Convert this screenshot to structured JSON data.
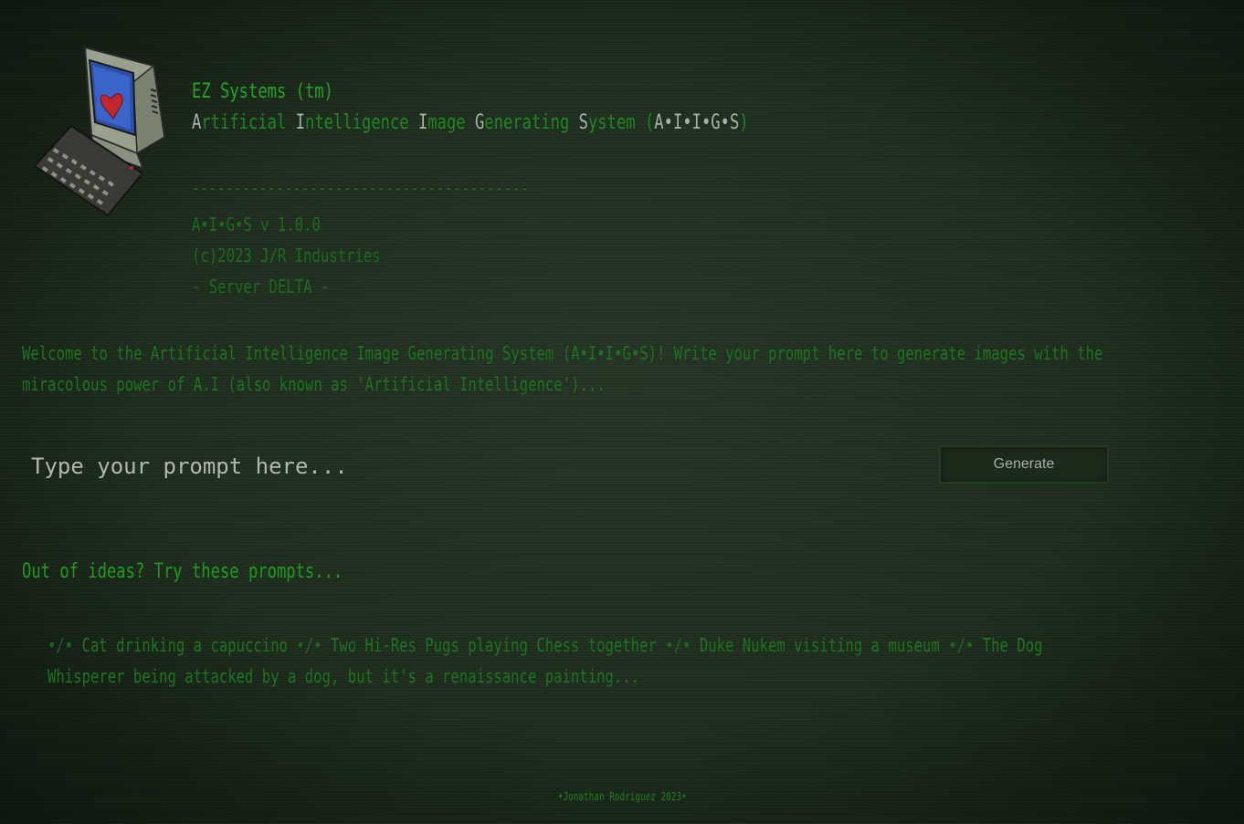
{
  "header": {
    "brand": "EZ Systems (tm)",
    "title_parts": [
      {
        "cap": "A",
        "rest": "rtificial"
      },
      {
        "cap": "I",
        "rest": "ntelligence"
      },
      {
        "cap": "I",
        "rest": "mage"
      },
      {
        "cap": "G",
        "rest": "enerating"
      },
      {
        "cap": "S",
        "rest": "ystem"
      }
    ],
    "acronym_open": "(",
    "acronym": "A•I•I•G•S",
    "acronym_close": ")",
    "divider": "----------------------------------------",
    "version": "A•I•G•S v 1.0.0",
    "copyright": "(c)2023 J/R Industries",
    "server": "- Server DELTA -"
  },
  "welcome": "Welcome to the Artificial Intelligence Image Generating System (A•I•I•G•S)! Write your prompt here to generate images with the miracolous power of A.I (also known as 'Artificial Intelligence')...",
  "prompt": {
    "placeholder": "Type your prompt here...",
    "value": ""
  },
  "generate_button": "Generate",
  "ideas_heading": "Out of ideas? Try these prompts...",
  "separator": "•/•",
  "suggestions": [
    "Cat drinking a capuccino",
    "Two Hi-Res Pugs playing Chess together",
    "Duke Nukem visiting a museum",
    "The Dog Whisperer being attacked by a dog, but it's a renaissance painting..."
  ],
  "footer": "•Jonathan Rodriguez 2023•",
  "icons": {
    "logo": "retro-computer-heart-icon"
  },
  "colors": {
    "text_green": "#1f7a1f",
    "bright_green": "#24a124",
    "highlight_gray": "#a8b0a8"
  }
}
